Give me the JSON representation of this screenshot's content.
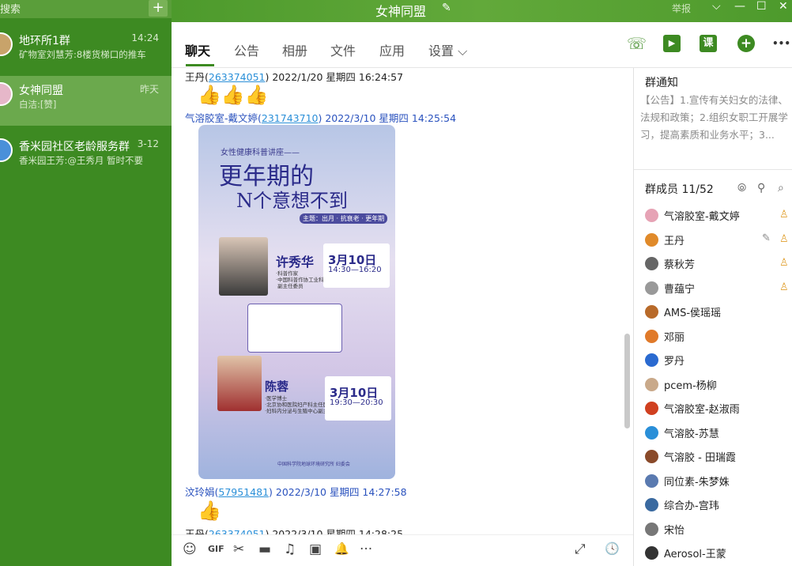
{
  "search": {
    "placeholder": "搜索",
    "plus": "+"
  },
  "conversations": [
    {
      "name": "地环所1群",
      "time": "14:24",
      "preview": "矿物室刘慧芳:8楼货梯口的推车",
      "avatar_color": "#c8a36a"
    },
    {
      "name": "女神同盟",
      "time": "昨天",
      "preview": "白洁:[赞]",
      "avatar_color": "#e6b7c9"
    },
    {
      "name": "香米园社区老龄服务群",
      "time": "3-12",
      "preview": "香米园王芳:@王秀月 暂时不要",
      "avatar_color": "#4a90d9"
    }
  ],
  "titlebar": {
    "title": "女神同盟",
    "edit_icon": "✎",
    "report": "举报",
    "chevron": "⌵",
    "minimize": "—",
    "maximize": "☐",
    "close": "✕"
  },
  "tabs": [
    "聊天",
    "公告",
    "相册",
    "文件",
    "应用",
    "设置 ⌵"
  ],
  "tab_icons": [
    {
      "name": "phone-icon",
      "glyph": "☏",
      "color": "#3d8a22"
    },
    {
      "name": "video-icon",
      "glyph": "▶",
      "color": "#3d8a22"
    },
    {
      "name": "class-icon",
      "glyph": "课",
      "color": "#3d8a22"
    },
    {
      "name": "add-icon",
      "glyph": "+",
      "color": "#3d8a22"
    },
    {
      "name": "more-icon",
      "glyph": "•••",
      "color": "#333"
    }
  ],
  "messages": [
    {
      "sender": "王丹",
      "qq": "263374051",
      "time": "2022/1/20 星期四 16:24:57",
      "content": "👍👍👍"
    },
    {
      "sender": "气溶胶室-戴文婷",
      "qq": "231743710",
      "time": "2022/3/10 星期四 14:25:54",
      "content": "poster"
    },
    {
      "sender": "汶玲娟",
      "qq": "57951481",
      "time": "2022/3/10 星期四 14:27:58",
      "content": "👍"
    },
    {
      "sender": "王丹",
      "qq": "263374051",
      "time": "2022/3/10 星期四 14:28:25",
      "content": ""
    }
  ],
  "poster": {
    "header": "女性健康科普讲座——",
    "title_line1": "更年期的",
    "title_line2": "N个意想不到",
    "tag": "主题：出月 · 抗衰老 · 更年期",
    "speaker1": "许秀华",
    "speaker1_info": "·科普作家\n·中国科普作协工业科普委员会\n 副主任委员",
    "date1": "3月10日",
    "time1": "14:30—16:20",
    "speaker2": "陈蓉",
    "speaker2_info": "·医学博士\n·北京协和医院妇产科主任医师\n·妇科内分泌与生殖中心副主任",
    "date2": "3月10日",
    "time2": "19:30—20:30",
    "footer": "中国科学院地球环境研究所 妇委会"
  },
  "toolbar": {
    "emoji": "☺",
    "gif": "GIF",
    "scissors": "✂",
    "folder": "▬",
    "music": "♫",
    "image": "▣",
    "bell": "🔔",
    "more": "···",
    "expand": "⤢",
    "history": "🕓"
  },
  "right": {
    "notice_title": "群通知",
    "notice_text": "【公告】1.宣传有关妇女的法律、法规和政策；2.组织女职工开展学习，提高素质和业务水平；3...",
    "members_title": "群成员 11/52",
    "icons": [
      "⦾",
      "⚲",
      "⌕"
    ],
    "members": [
      {
        "name": "气溶胶室-戴文婷",
        "color": "#e6a3b5",
        "badge": true,
        "edit": false
      },
      {
        "name": "王丹",
        "color": "#e08a2a",
        "badge": true,
        "edit": true
      },
      {
        "name": "蔡秋芳",
        "color": "#666",
        "badge": true,
        "edit": false
      },
      {
        "name": "曹蕴宁",
        "color": "#999",
        "badge": true,
        "edit": false
      },
      {
        "name": "AMS-侯瑶瑶",
        "color": "#b86a2a",
        "badge": false,
        "edit": false
      },
      {
        "name": "邓丽",
        "color": "#e07a2a",
        "badge": false,
        "edit": false
      },
      {
        "name": "罗丹",
        "color": "#2a6ad0",
        "badge": false,
        "edit": false
      },
      {
        "name": "pcem-杨柳",
        "color": "#c9a98a",
        "badge": false,
        "edit": false
      },
      {
        "name": "气溶胶室-赵淑雨",
        "color": "#d04020",
        "badge": false,
        "edit": false
      },
      {
        "name": "气溶胶-苏慧",
        "color": "#2a8fd8",
        "badge": false,
        "edit": false
      },
      {
        "name": "气溶胶 - 田瑞霞",
        "color": "#8a4a2a",
        "badge": false,
        "edit": false
      },
      {
        "name": "同位素-朱梦姝",
        "color": "#5a7ab0",
        "badge": false,
        "edit": false
      },
      {
        "name": "综合办-宫玮",
        "color": "#3a6aa0",
        "badge": false,
        "edit": false
      },
      {
        "name": "宋怡",
        "color": "#777",
        "badge": false,
        "edit": false
      },
      {
        "name": "Aerosol-王蒙",
        "color": "#333",
        "badge": false,
        "edit": false
      }
    ]
  }
}
